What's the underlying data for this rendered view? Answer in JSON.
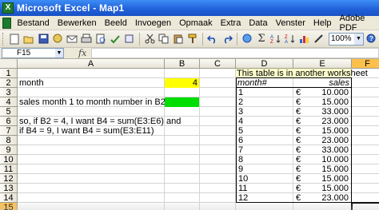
{
  "window": {
    "title": "Microsoft Excel - Map1"
  },
  "menu": [
    "Bestand",
    "Bewerken",
    "Beeld",
    "Invoegen",
    "Opmaak",
    "Extra",
    "Data",
    "Venster",
    "Help",
    "Adobe PDF"
  ],
  "toolbar": {
    "zoom": "100%"
  },
  "formula_bar": {
    "name_box": "F15",
    "fx": "fx",
    "formula": ""
  },
  "columns": [
    "A",
    "B",
    "C",
    "D",
    "E",
    "F"
  ],
  "rows": [
    "1",
    "2",
    "3",
    "4",
    "5",
    "6",
    "7",
    "8",
    "9",
    "10",
    "11",
    "12",
    "13",
    "14",
    "15"
  ],
  "cells": {
    "A2": "month",
    "B2": "4",
    "A4": "sales month 1 to month number in B2",
    "A6": "so, if B2 = 4, I want B4 = sum(E3:E6) and",
    "A7": "if B4 = 9, I want B4 = sum(E3:E11)",
    "D1": "This table is in another worksheet",
    "D2": "month#",
    "E2": "sales"
  },
  "table": [
    {
      "month": "1",
      "currency": "€",
      "sales": "10.000"
    },
    {
      "month": "2",
      "currency": "€",
      "sales": "15.000"
    },
    {
      "month": "3",
      "currency": "€",
      "sales": "33.000"
    },
    {
      "month": "4",
      "currency": "€",
      "sales": "23.000"
    },
    {
      "month": "5",
      "currency": "€",
      "sales": "15.000"
    },
    {
      "month": "6",
      "currency": "€",
      "sales": "23.000"
    },
    {
      "month": "7",
      "currency": "€",
      "sales": "33.000"
    },
    {
      "month": "8",
      "currency": "€",
      "sales": "10.000"
    },
    {
      "month": "9",
      "currency": "€",
      "sales": "15.000"
    },
    {
      "month": "10",
      "currency": "€",
      "sales": "15.000"
    },
    {
      "month": "11",
      "currency": "€",
      "sales": "15.000"
    },
    {
      "month": "12",
      "currency": "€",
      "sales": "23.000"
    }
  ],
  "colors": {
    "highlight_yellow": "#ffff00",
    "highlight_green": "#00dd00",
    "selected_header": "#ffc04b"
  }
}
